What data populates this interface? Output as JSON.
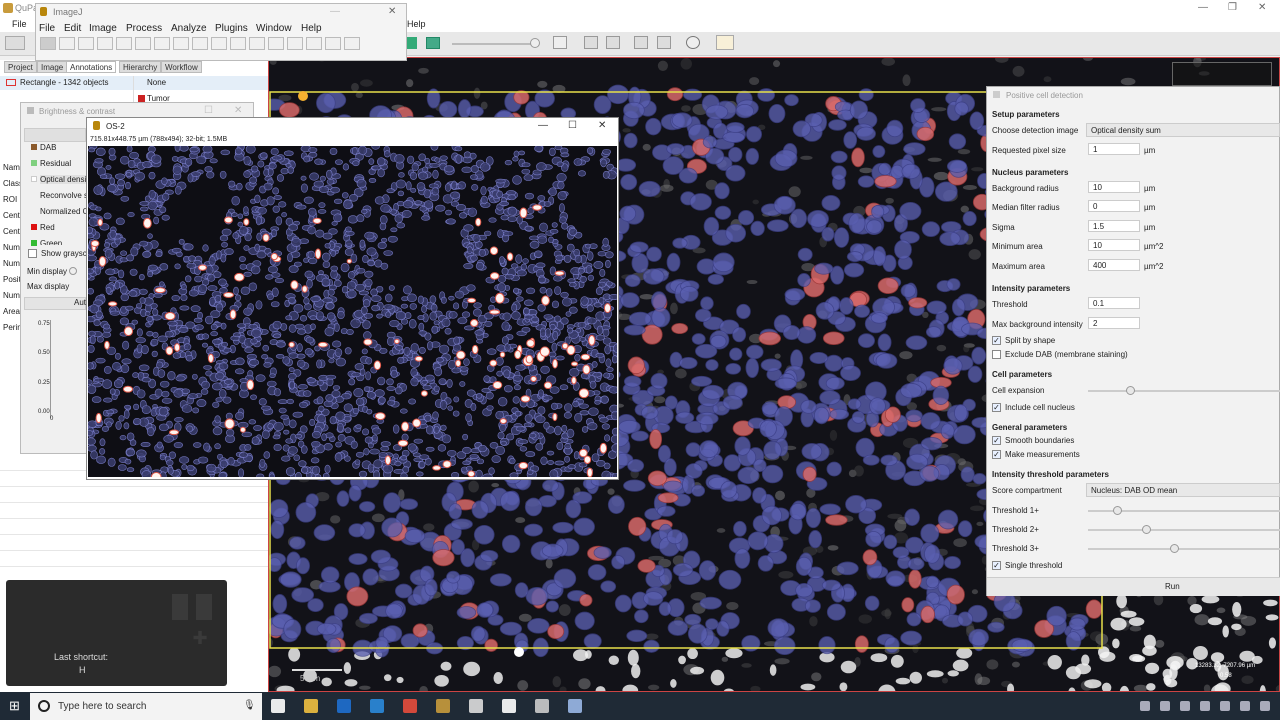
{
  "qupath": {
    "title": "QuPa",
    "menu": [
      "File"
    ],
    "help": "Help",
    "tabs": [
      "Project",
      "Image",
      "Annotations",
      "Hierarchy",
      "Workflow"
    ],
    "annotation_row": {
      "name": "Rectangle - 1342 objects",
      "class": "None"
    },
    "class_row": {
      "name": "Tumor"
    },
    "measure_labels": [
      "Name",
      "Class",
      "ROI",
      "Centr",
      "Centr",
      "Num",
      "Num",
      "Posit",
      "Num",
      "Area",
      "Perim"
    ]
  },
  "imagej": {
    "title": "ImageJ",
    "menu": [
      "File",
      "Edit",
      "Image",
      "Process",
      "Analyze",
      "Plugins",
      "Window",
      "Help"
    ]
  },
  "bc": {
    "title": "Brightness & contrast",
    "channels": [
      {
        "name": "DAB",
        "color": "#8B5A2B"
      },
      {
        "name": "Residual",
        "color": "#80d080"
      },
      {
        "name": "Optical densi",
        "color": ""
      },
      {
        "name": "Reconvolve s",
        "color": ""
      },
      {
        "name": "Normalized C",
        "color": ""
      },
      {
        "name": "Red",
        "color": "#dd1111"
      },
      {
        "name": "Green",
        "color": "#33bb33"
      }
    ],
    "show_grayscale": "Show graysc",
    "min_display": "Min display",
    "max_display": "Max display",
    "auto": "Aut",
    "hist_ticks": [
      "0.75",
      "0.50",
      "0.25",
      "0.00",
      "0"
    ]
  },
  "os2": {
    "title": "OS-2",
    "info": "715.81x448.75 µm (788x494); 32-bit; 1.5MB"
  },
  "pcd": {
    "title": "Positive cell detection",
    "sections": {
      "setup": "Setup parameters",
      "nucleus": "Nucleus parameters",
      "intensity": "Intensity parameters",
      "cell": "Cell parameters",
      "general": "General parameters",
      "threshold": "Intensity threshold parameters"
    },
    "choose_image": {
      "label": "Choose detection image",
      "value": "Optical density sum"
    },
    "pixel_size": {
      "label": "Requested pixel size",
      "value": "1",
      "unit": "µm"
    },
    "bg_radius": {
      "label": "Background radius",
      "value": "10",
      "unit": "µm"
    },
    "median_radius": {
      "label": "Median filter radius",
      "value": "0",
      "unit": "µm"
    },
    "sigma": {
      "label": "Sigma",
      "value": "1.5",
      "unit": "µm"
    },
    "min_area": {
      "label": "Minimum area",
      "value": "10",
      "unit": "µm^2"
    },
    "max_area": {
      "label": "Maximum area",
      "value": "400",
      "unit": "µm^2"
    },
    "threshold": {
      "label": "Threshold",
      "value": "0.1"
    },
    "max_bg": {
      "label": "Max background intensity",
      "value": "2"
    },
    "split_shape": {
      "label": "Split by shape",
      "checked": true
    },
    "exclude_dab": {
      "label": "Exclude DAB (membrane staining)",
      "checked": false
    },
    "cell_expansion": {
      "label": "Cell expansion",
      "level": 0.22
    },
    "include_nucleus": {
      "label": "Include cell nucleus",
      "checked": true
    },
    "smooth": {
      "label": "Smooth boundaries",
      "checked": true
    },
    "make_measure": {
      "label": "Make measurements",
      "checked": true
    },
    "score_comp": {
      "label": "Score compartment",
      "value": "Nucleus: DAB OD mean"
    },
    "t1": {
      "label": "Threshold 1+",
      "level": 0.15
    },
    "t2": {
      "label": "Threshold 2+",
      "level": 0.3
    },
    "t3": {
      "label": "Threshold 3+",
      "level": 0.45
    },
    "single": {
      "label": "Single threshold",
      "checked": true
    },
    "run": "Run"
  },
  "viewer": {
    "scale_label": "50µm",
    "coords": "13283.32, 7207.96 µm",
    "value": "0.58"
  },
  "shortcut": {
    "label": "Last shortcut:",
    "key": "H"
  },
  "taskbar": {
    "search_placeholder": "Type here to search"
  },
  "colors": {
    "accent": "#0078d7",
    "nucleus_neg": "#5a5fb0",
    "nucleus_pos": "#e06060"
  }
}
